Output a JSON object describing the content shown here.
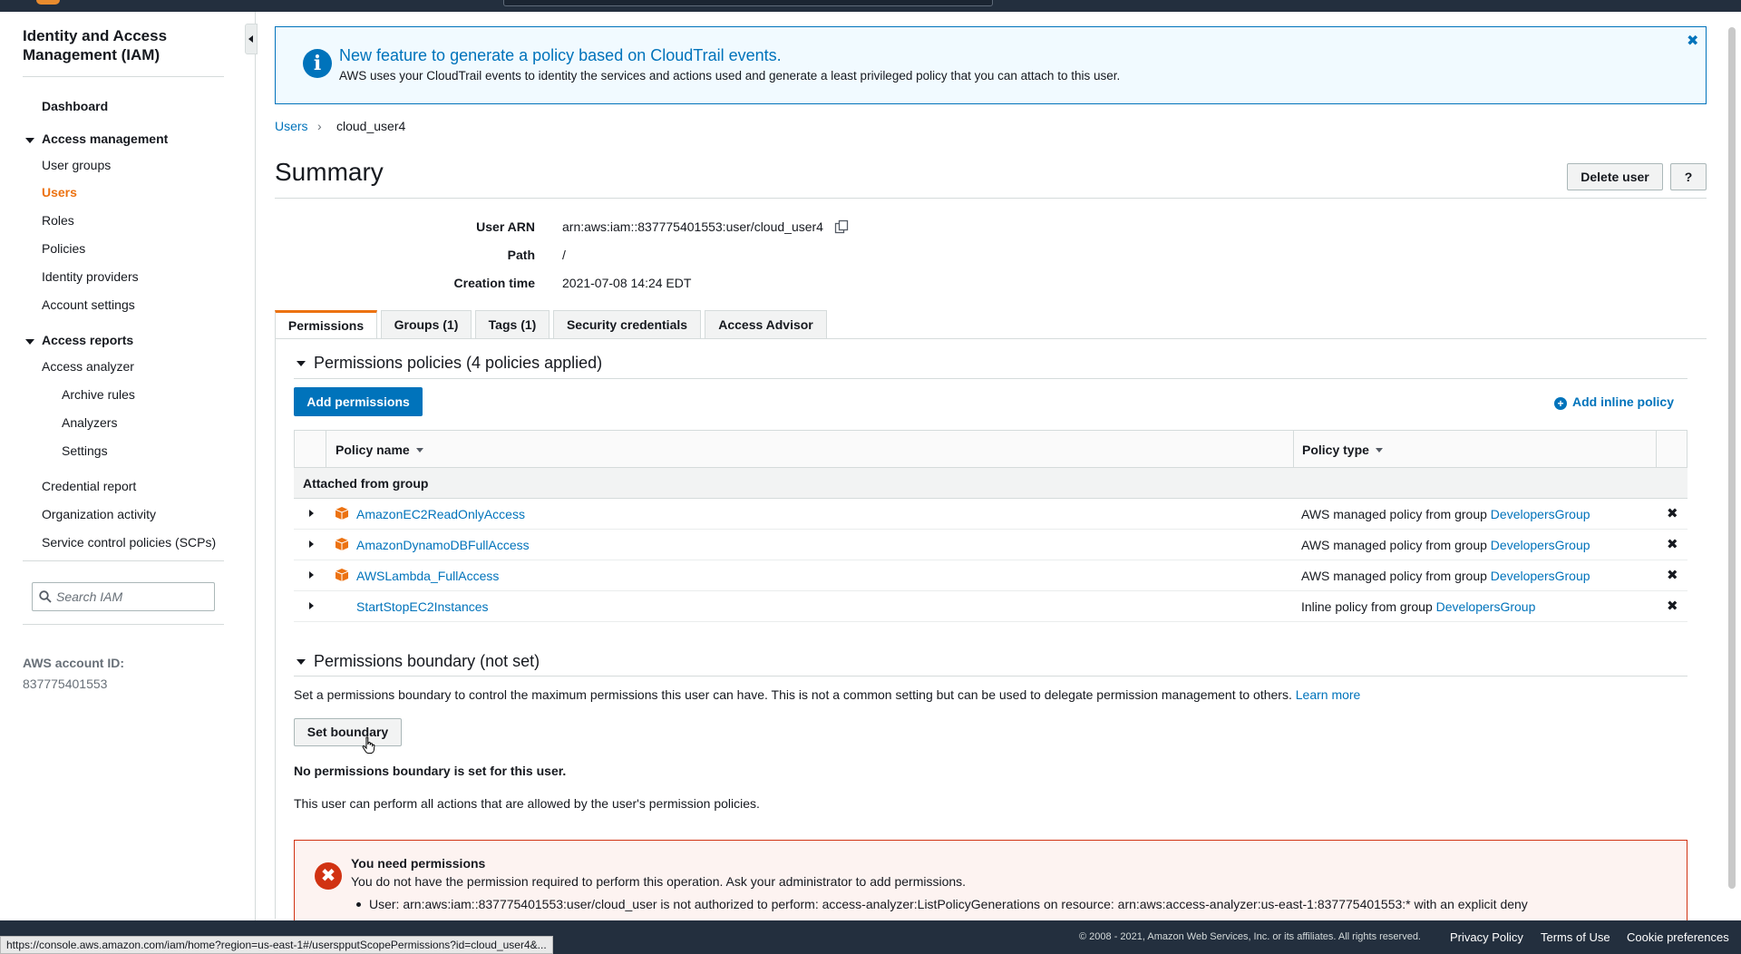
{
  "sidebar": {
    "title": "Identity and Access Management (IAM)",
    "dashboard": "Dashboard",
    "access_management": "Access management",
    "user_groups": "User groups",
    "users": "Users",
    "roles": "Roles",
    "policies": "Policies",
    "identity_providers": "Identity providers",
    "account_settings": "Account settings",
    "access_reports": "Access reports",
    "access_analyzer": "Access analyzer",
    "archive_rules": "Archive rules",
    "analyzers": "Analyzers",
    "settings": "Settings",
    "credential_report": "Credential report",
    "organization_activity": "Organization activity",
    "scps": "Service control policies (SCPs)",
    "search_placeholder": "Search IAM",
    "account_id_label": "AWS account ID:",
    "account_id": "837775401553"
  },
  "banner": {
    "title": "New feature to generate a policy based on CloudTrail events.",
    "text": "AWS uses your CloudTrail events to identity the services and actions used and generate a least privileged policy that you can attach to this user.",
    "close": "✖"
  },
  "breadcrumb": {
    "parent": "Users",
    "separator": "›",
    "current": "cloud_user4"
  },
  "summary": {
    "title": "Summary",
    "delete_button": "Delete user",
    "help_button": "?",
    "user_arn_label": "User ARN",
    "user_arn": "arn:aws:iam::837775401553:user/cloud_user4",
    "path_label": "Path",
    "path": "/",
    "creation_label": "Creation time",
    "creation_time": "2021-07-08 14:24 EDT"
  },
  "tabs": [
    {
      "label": "Permissions"
    },
    {
      "label": "Groups (1)"
    },
    {
      "label": "Tags (1)"
    },
    {
      "label": "Security credentials"
    },
    {
      "label": "Access Advisor"
    }
  ],
  "permissions": {
    "section_title": "Permissions policies (4 policies applied)",
    "add_button": "Add permissions",
    "add_inline": "Add inline policy",
    "col_name": "Policy name",
    "col_type": "Policy type",
    "group_label": "Attached from group",
    "rows": [
      {
        "name": "AmazonEC2ReadOnlyAccess",
        "type": "AWS managed policy from group ",
        "group": "DevelopersGroup"
      },
      {
        "name": "AmazonDynamoDBFullAccess",
        "type": "AWS managed policy from group ",
        "group": "DevelopersGroup"
      },
      {
        "name": "AWSLambda_FullAccess",
        "type": "AWS managed policy from group ",
        "group": "DevelopersGroup"
      },
      {
        "name": "StartStopEC2Instances",
        "type": "Inline policy from group ",
        "group": "DevelopersGroup"
      }
    ],
    "remove": "✖"
  },
  "boundary": {
    "section_title": "Permissions boundary (not set)",
    "description": "Set a permissions boundary to control the maximum permissions this user can have. This is not a common setting but can be used to delegate permission management to others. ",
    "learn_more": "Learn more",
    "set_button": "Set boundary",
    "none_set": "No permissions boundary is set for this user.",
    "can_perform": "This user can perform all actions that are allowed by the user's permission policies."
  },
  "error": {
    "icon": "✖",
    "title": "You need permissions",
    "text": "You do not have the permission required to perform this operation. Ask your administrator to add permissions.",
    "detail": "User: arn:aws:iam::837775401553:user/cloud_user is not authorized to perform: access-analyzer:ListPolicyGenerations on resource: arn:aws:access-analyzer:us-east-1:837775401553:* with an explicit deny"
  },
  "footer": {
    "status_url": "https://console.aws.amazon.com/iam/home?region=us-east-1#/userspputScopePermissions?id=cloud_user4&...",
    "copyright": "© 2008 - 2021, Amazon Web Services, Inc. or its affiliates. All rights reserved.",
    "privacy": "Privacy Policy",
    "terms": "Terms of Use",
    "cookies": "Cookie preferences"
  },
  "colors": {
    "accent": "#ec7211",
    "link": "#0073bb",
    "error": "#d13212",
    "nav_bg": "#232f3e"
  }
}
